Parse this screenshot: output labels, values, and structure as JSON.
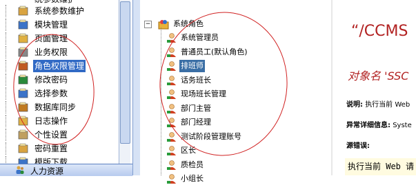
{
  "menu": {
    "top_cut": "统参数维护",
    "items": [
      {
        "label": "系统参数维护",
        "icon": "folder-settings-icon"
      },
      {
        "label": "模块管理",
        "icon": "module-icon"
      },
      {
        "label": "页面管理",
        "icon": "page-icon"
      },
      {
        "label": "业务权限",
        "icon": "document-icon"
      },
      {
        "label": "角色权限管理",
        "icon": "role-permission-icon"
      },
      {
        "label": "修改密码",
        "icon": "pencil-check-icon"
      },
      {
        "label": "选择参数",
        "icon": "select-param-icon"
      },
      {
        "label": "数据库同步",
        "icon": "database-sync-icon"
      },
      {
        "label": "日志操作",
        "icon": "log-icon"
      },
      {
        "label": "个性设置",
        "icon": "personalize-icon"
      },
      {
        "label": "密码重置",
        "icon": "password-reset-icon"
      },
      {
        "label": "模版下载",
        "icon": "template-download-icon"
      }
    ],
    "selected_index": 4,
    "bottom_tab": "人力资源"
  },
  "tree": {
    "root": "系统角色",
    "nodes": [
      {
        "label": "系统管理员"
      },
      {
        "label": "普通员工(默认角色)"
      },
      {
        "label": "排班师"
      },
      {
        "label": "话务班长"
      },
      {
        "label": "现场班长管理"
      },
      {
        "label": "部门主管"
      },
      {
        "label": "部门经理"
      },
      {
        "label": "测试阶段管理账号"
      },
      {
        "label": "区长"
      },
      {
        "label": "质检员"
      },
      {
        "label": "小组长"
      }
    ],
    "selected_index": 2
  },
  "error": {
    "title": "“/CCMS",
    "object": "对象名 'SSC",
    "desc_label": "说明:",
    "desc_text": "执行当前 Web",
    "detail_label": "异常详细信息:",
    "detail_text": "Syste",
    "source_label": "源错误:",
    "source_text": "执行当前 Web 请"
  },
  "colors": {
    "selection": "#316ac5",
    "annotation_circle": "#d02020",
    "error_red": "#b22222"
  }
}
